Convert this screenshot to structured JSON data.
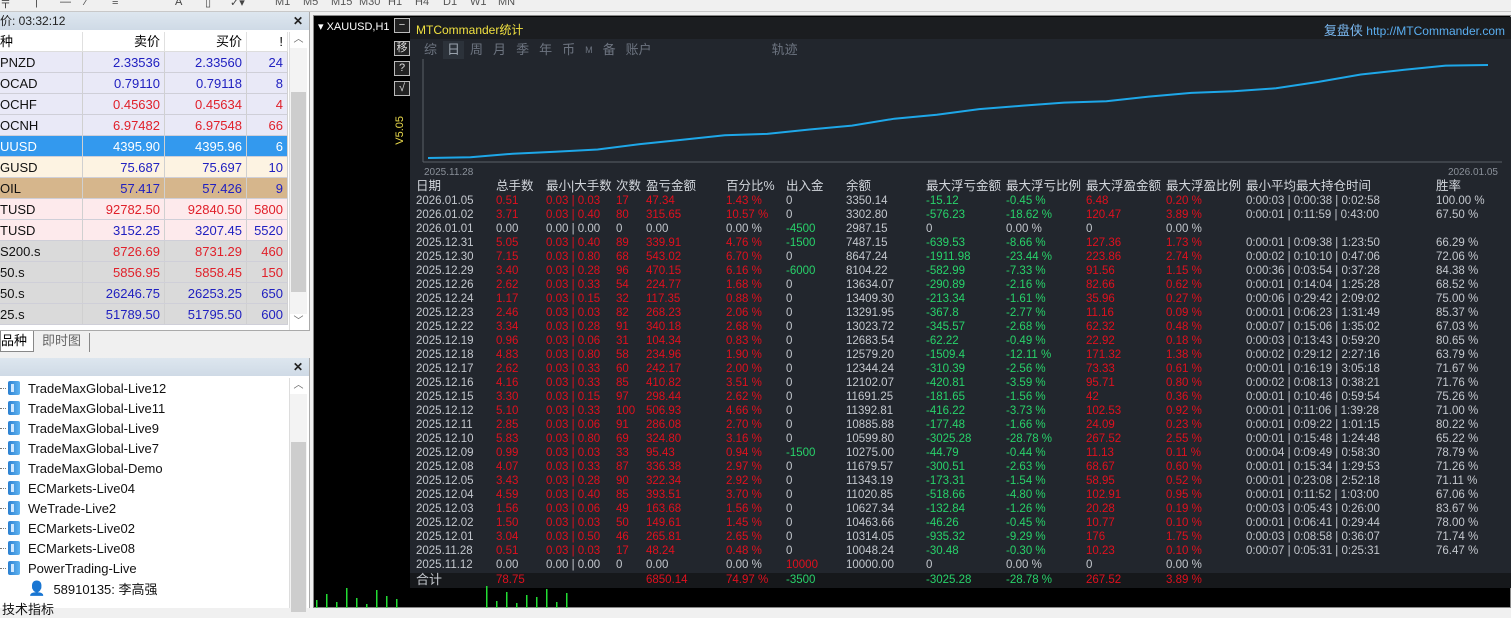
{
  "toolbar": {
    "timeframes": [
      "M1",
      "M5",
      "M15",
      "M30",
      "H1",
      "H4",
      "D1",
      "W1",
      "MN"
    ]
  },
  "market_watch": {
    "title": "价: 03:32:12",
    "headers": [
      "种",
      "卖价",
      "买价",
      "!"
    ],
    "rows": [
      {
        "symbol": "PNZD",
        "bid": "2.33536",
        "ask": "2.33560",
        "spread": "24",
        "color": "#2020c0",
        "bg": "#e9e9f7"
      },
      {
        "symbol": "OCAD",
        "bid": "0.79110",
        "ask": "0.79118",
        "spread": "8",
        "color": "#2020c0",
        "bg": "#e9e9f7"
      },
      {
        "symbol": "OCHF",
        "bid": "0.45630",
        "ask": "0.45634",
        "spread": "4",
        "color": "#e0202a",
        "bg": "#e9e9f7"
      },
      {
        "symbol": "OCNH",
        "bid": "6.97482",
        "ask": "6.97548",
        "spread": "66",
        "color": "#e0202a",
        "bg": "#e9e9f7"
      },
      {
        "symbol": "UUSD",
        "bid": "4395.90",
        "ask": "4395.96",
        "spread": "6",
        "color": "#ffffff",
        "bg": "#3399ee"
      },
      {
        "symbol": "GUSD",
        "bid": "75.687",
        "ask": "75.697",
        "spread": "10",
        "color": "#2020c0",
        "bg": "#fdf3e2"
      },
      {
        "symbol": "OIL",
        "bid": "57.417",
        "ask": "57.426",
        "spread": "9",
        "color": "#2020c0",
        "bg": "#d6b68c"
      },
      {
        "symbol": "TUSD",
        "bid": "92782.50",
        "ask": "92840.50",
        "spread": "5800",
        "color": "#e0202a",
        "bg": "#fdeaec"
      },
      {
        "symbol": "TUSD",
        "bid": "3152.25",
        "ask": "3207.45",
        "spread": "5520",
        "color": "#2020c0",
        "bg": "#fdeaec"
      },
      {
        "symbol": "S200.s",
        "bid": "8726.69",
        "ask": "8731.29",
        "spread": "460",
        "color": "#e0202a",
        "bg": "#dadada"
      },
      {
        "symbol": "50.s",
        "bid": "5856.95",
        "ask": "5858.45",
        "spread": "150",
        "color": "#e0202a",
        "bg": "#dadada"
      },
      {
        "symbol": "50.s",
        "bid": "26246.75",
        "ask": "26253.25",
        "spread": "650",
        "color": "#2020c0",
        "bg": "#dadada"
      },
      {
        "symbol": "25.s",
        "bid": "51789.50",
        "ask": "51795.50",
        "spread": "600",
        "color": "#2020c0",
        "bg": "#dadada"
      }
    ],
    "tabs": [
      "品种",
      "即时图"
    ]
  },
  "navigator": {
    "servers": [
      "TradeMaxGlobal-Live12",
      "TradeMaxGlobal-Live11",
      "TradeMaxGlobal-Live9",
      "TradeMaxGlobal-Live7",
      "TradeMaxGlobal-Demo",
      "ECMarkets-Live04",
      "WeTrade-Live2",
      "ECMarkets-Live02",
      "ECMarkets-Live08",
      "PowerTrading-Live"
    ],
    "account": "58910135: 李高强",
    "next_section": "技术指标"
  },
  "chart": {
    "symbol_label": "XAUUSD,H1",
    "side_buttons": [
      "−",
      "移",
      "?",
      "√"
    ],
    "version": "V5.05"
  },
  "indicator": {
    "title": "MTCommander统计",
    "brand": "复盘侠",
    "url": "http://MTCommander.com",
    "tabs": [
      "综",
      "日",
      "周",
      "月",
      "季",
      "年",
      "币",
      "M",
      "备",
      "账户",
      "轨迹"
    ],
    "active_tab": "日",
    "curve_start_label": "2025.11.28",
    "curve_end_label": "2026.01.05",
    "line_color": "#1ea7e8"
  },
  "table": {
    "headers": [
      "日期",
      "总手数",
      "最小|大手数",
      "次数",
      "盈亏金额",
      "百分比%",
      "出入金",
      "余额",
      "最大浮亏金额",
      "最大浮亏比例",
      "最大浮盈金额",
      "最大浮盈比例",
      "最小平均最大持仓时间",
      "胜率"
    ],
    "rows": [
      [
        "2026.01.05",
        "0.51",
        "0.03 | 0.03",
        "17",
        "47.34",
        "1.43 %",
        "0",
        "3350.14",
        "-15.12",
        "-0.45 %",
        "6.48",
        "0.20 %",
        "0:00:03 | 0:00:38 | 0:02:58",
        "100.00 %"
      ],
      [
        "2026.01.02",
        "3.71",
        "0.03 | 0.40",
        "80",
        "315.65",
        "10.57 %",
        "0",
        "3302.80",
        "-576.23",
        "-18.62 %",
        "120.47",
        "3.89 %",
        "0:00:01 | 0:11:59 | 0:43:00",
        "67.50 %"
      ],
      [
        "2026.01.01",
        "0.00",
        "0.00 | 0.00",
        "0",
        "0.00",
        "0.00 %",
        "-4500",
        "2987.15",
        "0",
        "0.00 %",
        "0",
        "0.00 %",
        "",
        ""
      ],
      [
        "2025.12.31",
        "5.05",
        "0.03 | 0.40",
        "89",
        "339.91",
        "4.76 %",
        "-1500",
        "7487.15",
        "-639.53",
        "-8.66 %",
        "127.36",
        "1.73 %",
        "0:00:01 | 0:09:38 | 1:23:50",
        "66.29 %"
      ],
      [
        "2025.12.30",
        "7.15",
        "0.03 | 0.80",
        "68",
        "543.02",
        "6.70 %",
        "0",
        "8647.24",
        "-1911.98",
        "-23.44 %",
        "223.86",
        "2.74 %",
        "0:00:02 | 0:10:10 | 0:47:06",
        "72.06 %"
      ],
      [
        "2025.12.29",
        "3.40",
        "0.03 | 0.28",
        "96",
        "470.15",
        "6.16 %",
        "-6000",
        "8104.22",
        "-582.99",
        "-7.33 %",
        "91.56",
        "1.15 %",
        "0:00:36 | 0:03:54 | 0:37:28",
        "84.38 %"
      ],
      [
        "2025.12.26",
        "2.62",
        "0.03 | 0.33",
        "54",
        "224.77",
        "1.68 %",
        "0",
        "13634.07",
        "-290.89",
        "-2.16 %",
        "82.66",
        "0.62 %",
        "0:00:01 | 0:14:04 | 1:25:28",
        "68.52 %"
      ],
      [
        "2025.12.24",
        "1.17",
        "0.03 | 0.15",
        "32",
        "117.35",
        "0.88 %",
        "0",
        "13409.30",
        "-213.34",
        "-1.61 %",
        "35.96",
        "0.27 %",
        "0:00:06 | 0:29:42 | 2:09:02",
        "75.00 %"
      ],
      [
        "2025.12.23",
        "2.46",
        "0.03 | 0.03",
        "82",
        "268.23",
        "2.06 %",
        "0",
        "13291.95",
        "-367.8",
        "-2.77 %",
        "11.16",
        "0.09 %",
        "0:00:01 | 0:06:23 | 1:31:49",
        "85.37 %"
      ],
      [
        "2025.12.22",
        "3.34",
        "0.03 | 0.28",
        "91",
        "340.18",
        "2.68 %",
        "0",
        "13023.72",
        "-345.57",
        "-2.68 %",
        "62.32",
        "0.48 %",
        "0:00:07 | 0:15:06 | 1:35:02",
        "67.03 %"
      ],
      [
        "2025.12.19",
        "0.96",
        "0.03 | 0.06",
        "31",
        "104.34",
        "0.83 %",
        "0",
        "12683.54",
        "-62.22",
        "-0.49 %",
        "22.92",
        "0.18 %",
        "0:00:03 | 0:13:43 | 0:59:20",
        "80.65 %"
      ],
      [
        "2025.12.18",
        "4.83",
        "0.03 | 0.80",
        "58",
        "234.96",
        "1.90 %",
        "0",
        "12579.20",
        "-1509.4",
        "-12.11 %",
        "171.32",
        "1.38 %",
        "0:00:02 | 0:29:12 | 2:27:16",
        "63.79 %"
      ],
      [
        "2025.12.17",
        "2.62",
        "0.03 | 0.33",
        "60",
        "242.17",
        "2.00 %",
        "0",
        "12344.24",
        "-310.39",
        "-2.56 %",
        "73.33",
        "0.61 %",
        "0:00:01 | 0:16:19 | 3:05:18",
        "71.67 %"
      ],
      [
        "2025.12.16",
        "4.16",
        "0.03 | 0.33",
        "85",
        "410.82",
        "3.51 %",
        "0",
        "12102.07",
        "-420.81",
        "-3.59 %",
        "95.71",
        "0.80 %",
        "0:00:02 | 0:08:13 | 0:38:21",
        "71.76 %"
      ],
      [
        "2025.12.15",
        "3.30",
        "0.03 | 0.15",
        "97",
        "298.44",
        "2.62 %",
        "0",
        "11691.25",
        "-181.65",
        "-1.56 %",
        "42",
        "0.36 %",
        "0:00:01 | 0:10:46 | 0:59:54",
        "75.26 %"
      ],
      [
        "2025.12.12",
        "5.10",
        "0.03 | 0.33",
        "100",
        "506.93",
        "4.66 %",
        "0",
        "11392.81",
        "-416.22",
        "-3.73 %",
        "102.53",
        "0.92 %",
        "0:00:01 | 0:11:06 | 1:39:28",
        "71.00 %"
      ],
      [
        "2025.12.11",
        "2.85",
        "0.03 | 0.06",
        "91",
        "286.08",
        "2.70 %",
        "0",
        "10885.88",
        "-177.48",
        "-1.66 %",
        "24.09",
        "0.23 %",
        "0:00:01 | 0:09:22 | 1:01:15",
        "80.22 %"
      ],
      [
        "2025.12.10",
        "5.83",
        "0.03 | 0.80",
        "69",
        "324.80",
        "3.16 %",
        "0",
        "10599.80",
        "-3025.28",
        "-28.78 %",
        "267.52",
        "2.55 %",
        "0:00:01 | 0:15:48 | 1:24:48",
        "65.22 %"
      ],
      [
        "2025.12.09",
        "0.99",
        "0.03 | 0.03",
        "33",
        "95.43",
        "0.94 %",
        "-1500",
        "10275.00",
        "-44.79",
        "-0.44 %",
        "11.13",
        "0.11 %",
        "0:00:04 | 0:09:49 | 0:58:30",
        "78.79 %"
      ],
      [
        "2025.12.08",
        "4.07",
        "0.03 | 0.33",
        "87",
        "336.38",
        "2.97 %",
        "0",
        "11679.57",
        "-300.51",
        "-2.63 %",
        "68.67",
        "0.60 %",
        "0:00:01 | 0:15:34 | 1:29:53",
        "71.26 %"
      ],
      [
        "2025.12.05",
        "3.43",
        "0.03 | 0.28",
        "90",
        "322.34",
        "2.92 %",
        "0",
        "11343.19",
        "-173.31",
        "-1.54 %",
        "58.95",
        "0.52 %",
        "0:00:01 | 0:23:08 | 2:52:18",
        "71.11 %"
      ],
      [
        "2025.12.04",
        "4.59",
        "0.03 | 0.40",
        "85",
        "393.51",
        "3.70 %",
        "0",
        "11020.85",
        "-518.66",
        "-4.80 %",
        "102.91",
        "0.95 %",
        "0:00:01 | 0:11:52 | 1:03:00",
        "67.06 %"
      ],
      [
        "2025.12.03",
        "1.56",
        "0.03 | 0.06",
        "49",
        "163.68",
        "1.56 %",
        "0",
        "10627.34",
        "-132.84",
        "-1.26 %",
        "20.28",
        "0.19 %",
        "0:00:03 | 0:05:43 | 0:26:00",
        "83.67 %"
      ],
      [
        "2025.12.02",
        "1.50",
        "0.03 | 0.03",
        "50",
        "149.61",
        "1.45 %",
        "0",
        "10463.66",
        "-46.26",
        "-0.45 %",
        "10.77",
        "0.10 %",
        "0:00:01 | 0:06:41 | 0:29:44",
        "78.00 %"
      ],
      [
        "2025.12.01",
        "3.04",
        "0.03 | 0.50",
        "46",
        "265.81",
        "2.65 %",
        "0",
        "10314.05",
        "-935.32",
        "-9.29 %",
        "176",
        "1.75 %",
        "0:00:03 | 0:08:58 | 0:36:07",
        "71.74 %"
      ],
      [
        "2025.11.28",
        "0.51",
        "0.03 | 0.03",
        "17",
        "48.24",
        "0.48 %",
        "0",
        "10048.24",
        "-30.48",
        "-0.30 %",
        "10.23",
        "0.10 %",
        "0:00:07 | 0:05:31 | 0:25:31",
        "76.47 %"
      ],
      [
        "2025.11.12",
        "0.00",
        "0.00 | 0.00",
        "0",
        "0.00",
        "0.00 %",
        "10000",
        "10000.00",
        "0",
        "0.00 %",
        "0",
        "0.00 %",
        "",
        ""
      ]
    ],
    "total": [
      "合计",
      "78.75",
      "",
      "",
      "6850.14",
      "74.97 %",
      "-3500",
      "",
      "-3025.28",
      "-28.78 %",
      "267.52",
      "3.89 %",
      "",
      ""
    ]
  }
}
